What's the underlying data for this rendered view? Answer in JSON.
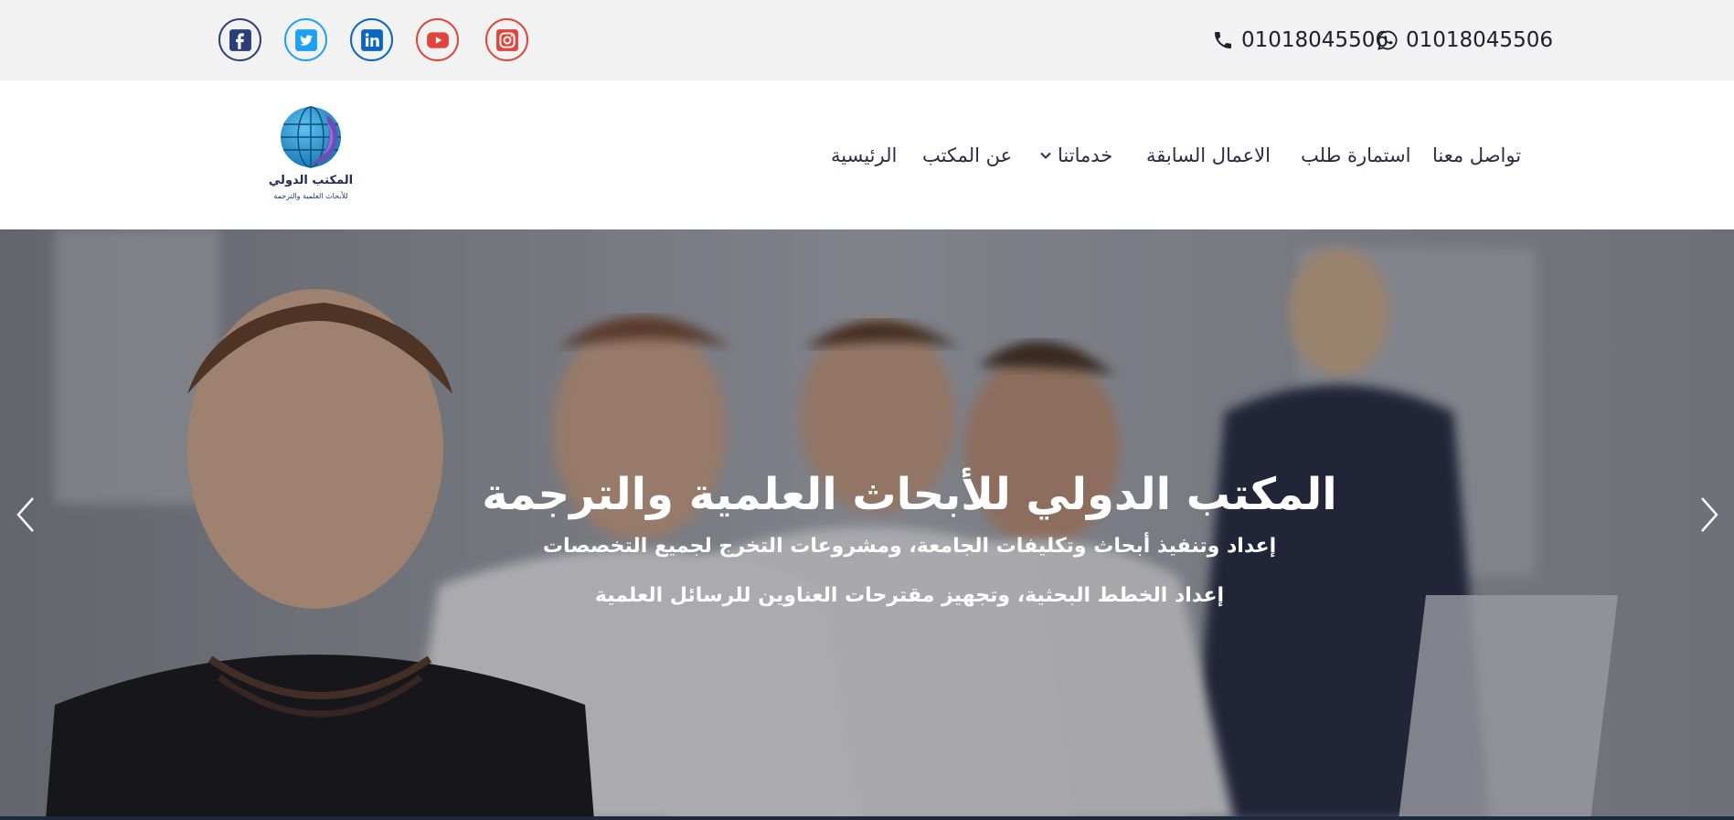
{
  "colors": {
    "facebook": "#2a3f7a",
    "twitter": "#1da1f2",
    "linkedin": "#0a66c2",
    "youtube": "#e0443a",
    "instagram": "#e0443a",
    "topbar_bg": "#f2f2f2",
    "nav_text": "#2b2b45"
  },
  "topbar": {
    "social_icons": [
      "facebook-icon",
      "twitter-icon",
      "linkedin-icon",
      "youtube-icon",
      "instagram-icon"
    ],
    "phone": "01018045506",
    "whatsapp": "01018045506"
  },
  "logo": {
    "name": "المكتب الدولي",
    "subtitle": "للأبحاث العلمية والترجمة"
  },
  "nav": {
    "contact": "تواصل معنا",
    "request_form": "استمارة طلب",
    "previous_works": "الاعمال السابقة",
    "services": "خدماتنا",
    "about": "عن المكتب",
    "home": "الرئيسية"
  },
  "hero": {
    "title": "المكتب الدولي للأبحاث العلمية والترجمة",
    "line1": "إعداد وتنفيذ أبحاث وتكليفات الجامعة، ومشروعات التخرج لجميع التخصصات",
    "line2": "إعداد الخطط البحثية، وتجهيز مقترحات العناوين للرسائل العلمية"
  }
}
